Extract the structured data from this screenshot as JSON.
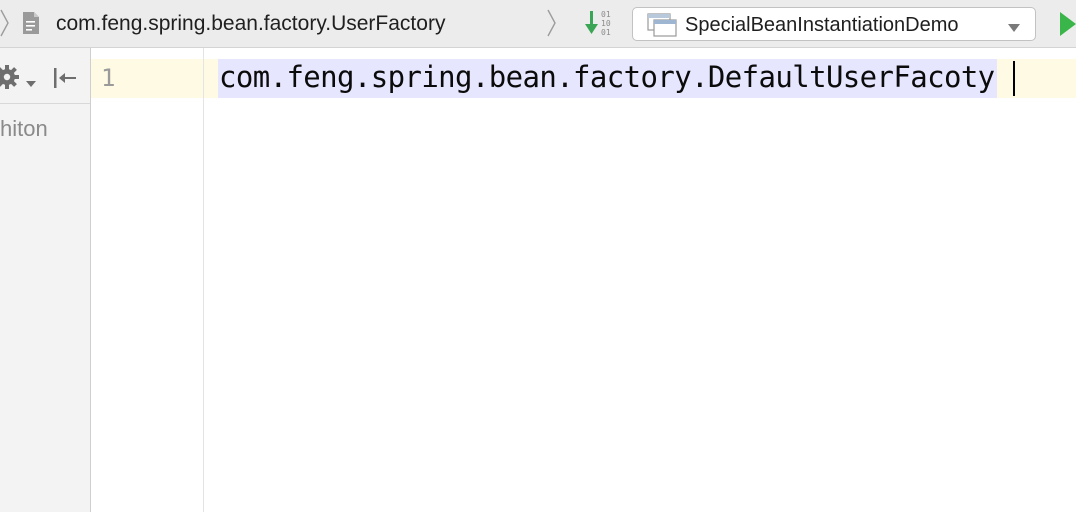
{
  "navbar": {
    "breadcrumb": "com.feng.spring.bean.factory.UserFactory",
    "icons": {
      "file": "java-file-icon",
      "build": "build-project-icon",
      "run": "run-icon"
    },
    "run_configuration": {
      "label": "SpecialBeanInstantiationDemo",
      "icon": "application-config-icon"
    }
  },
  "left_panel": {
    "toolbar_icons": [
      "gear-icon",
      "chevron-down-icon",
      "collapse-all-icon"
    ],
    "item_label": "hiton"
  },
  "editor": {
    "line_numbers": [
      "1"
    ],
    "lines": [
      "com.feng.spring.bean.factory.DefaultUserFacoty"
    ]
  },
  "colors": {
    "current_line": "#fffae3",
    "selection": "#e6e6ff",
    "run_green": "#3ab54a",
    "build_green": "#3aa655"
  }
}
